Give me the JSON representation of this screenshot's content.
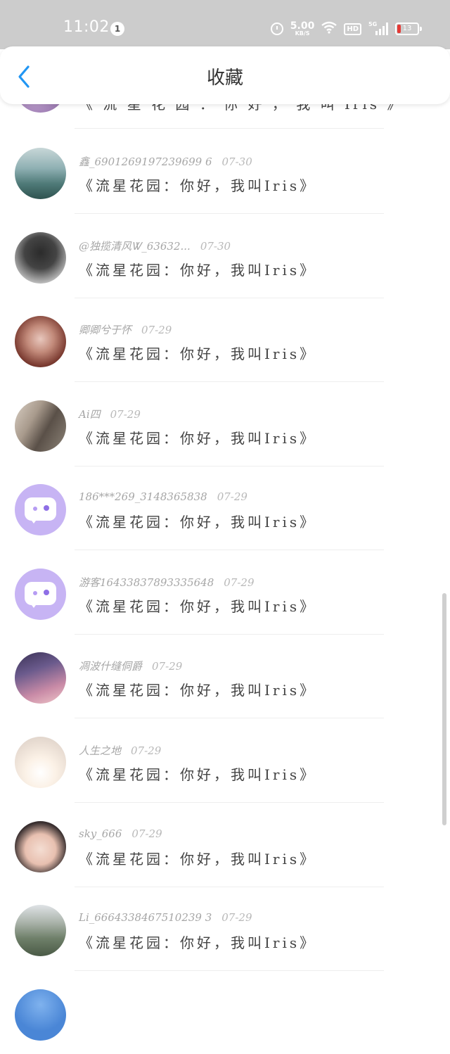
{
  "status_bar": {
    "time": "11:02",
    "notification_count": "1",
    "net_speed_value": "5.00",
    "net_speed_unit": "KB/S",
    "hd_label": "HD",
    "signal_label": "5G",
    "battery_level": "13"
  },
  "header": {
    "title": "收藏",
    "back_icon": "chevron-left-icon",
    "back_color": "#2196f3"
  },
  "colors": {
    "status_bar_bg": "#cccccc",
    "avatar_default_bg": "#c7b4f4",
    "meta_text": "#a6a6a6",
    "message_text": "#444444"
  },
  "items": [
    {
      "user": "",
      "date": "",
      "message": "《 流 星 花 园 ： 你 好 ， 我 叫 Iris 》",
      "avatar": "photo-purple"
    },
    {
      "user": "鑫_6901269197239699 6",
      "date": "07-30",
      "message": "《流星花园：你好，我叫Iris》",
      "avatar": "photo-lake"
    },
    {
      "user": "@独揽清风Ꮤ_63632...",
      "date": "07-30",
      "message": "《流星花园：你好，我叫Iris》",
      "avatar": "photo-girl-dark"
    },
    {
      "user": "卿卿兮于怀",
      "date": "07-29",
      "message": "《流星花园：你好，我叫Iris》",
      "avatar": "photo-girl-red"
    },
    {
      "user": "Ai四",
      "date": "07-29",
      "message": "《流星花园：你好，我叫Iris》",
      "avatar": "photo-scarf"
    },
    {
      "user": "186***269_3148365838",
      "date": "07-29",
      "message": "《流星花园：你好，我叫Iris》",
      "avatar": "default-chat"
    },
    {
      "user": "游客16433837893335648",
      "date": "07-29",
      "message": "《流星花园：你好，我叫Iris》",
      "avatar": "default-chat"
    },
    {
      "user": "凋波什缝侗爵",
      "date": "07-29",
      "message": "《流星花园：你好，我叫Iris》",
      "avatar": "photo-anime"
    },
    {
      "user": "人生之地",
      "date": "07-29",
      "message": "《流星花园：你好，我叫Iris》",
      "avatar": "photo-light"
    },
    {
      "user": "sky_666",
      "date": "07-29",
      "message": "《流星花园：你好，我叫Iris》",
      "avatar": "photo-face"
    },
    {
      "user": "Li_6664338467510239 3",
      "date": "07-29",
      "message": "《流星花园：你好，我叫Iris》",
      "avatar": "photo-mountain"
    },
    {
      "user": "",
      "date": "",
      "message": "",
      "avatar": "photo-blue"
    }
  ]
}
